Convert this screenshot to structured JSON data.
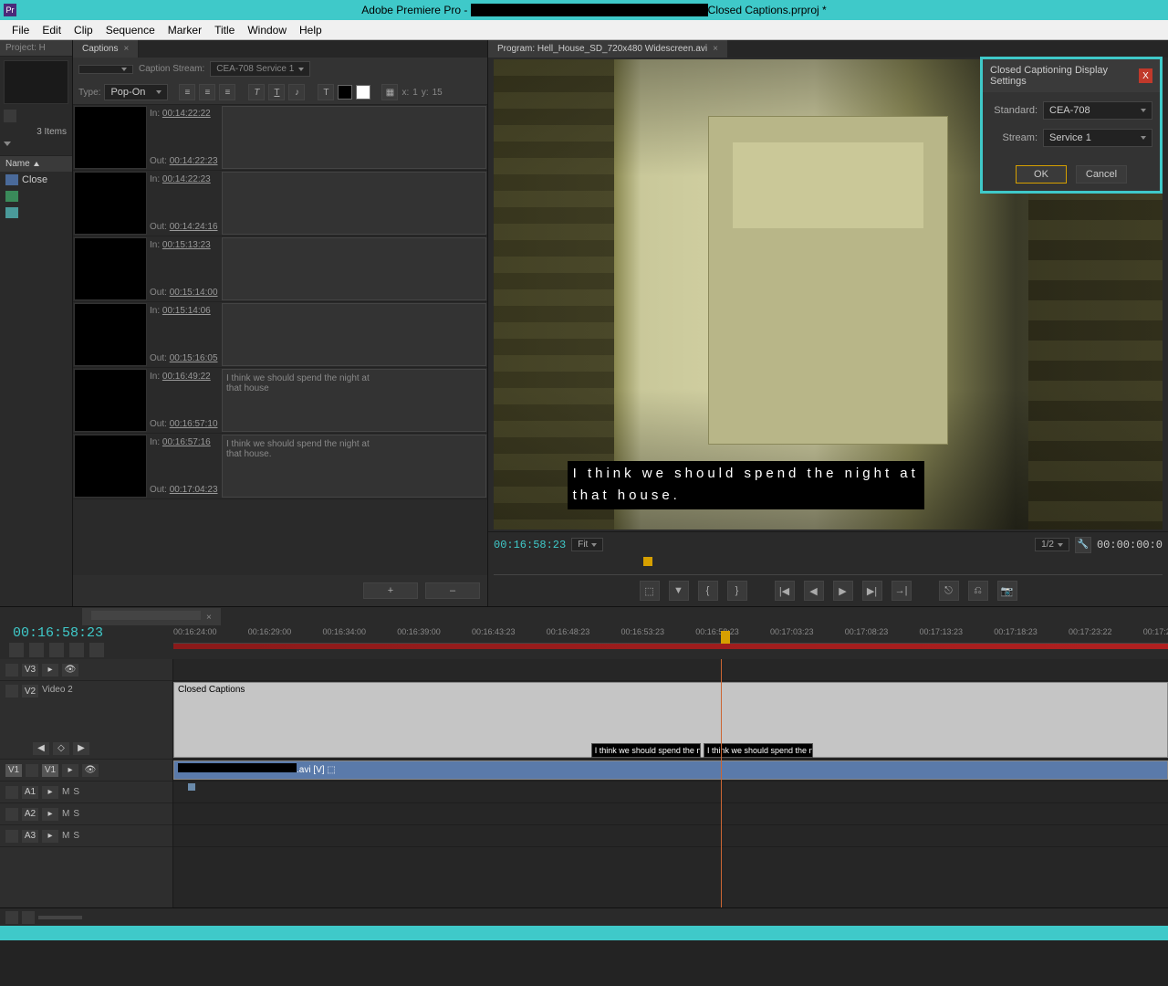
{
  "titlebar": {
    "app": "Adobe Premiere Pro - ",
    "file": "Closed Captions.prproj *"
  },
  "menu": [
    "File",
    "Edit",
    "Clip",
    "Sequence",
    "Marker",
    "Title",
    "Window",
    "Help"
  ],
  "project": {
    "tab": "Project: H",
    "items_count": "3 Items",
    "name_hdr": "Name",
    "items": [
      {
        "label": "Close"
      },
      {
        "label": ""
      },
      {
        "label": ""
      }
    ]
  },
  "captions": {
    "tab": "Captions",
    "stream_label": "Caption Stream:",
    "stream_value": "CEA-708 Service 1",
    "type_label": "Type:",
    "type_value": "Pop-On",
    "xy": {
      "x_label": "x:",
      "x_val": "1",
      "y_label": "y:",
      "y_val": "15"
    },
    "rows": [
      {
        "in": "00:14:22:22",
        "out": "00:14:22:23",
        "text": ""
      },
      {
        "in": "00:14:22:23",
        "out": "00:14:24:16",
        "text": ""
      },
      {
        "in": "00:15:13:23",
        "out": "00:15:14:00",
        "text": ""
      },
      {
        "in": "00:15:14:06",
        "out": "00:15:16:05",
        "text": ""
      },
      {
        "in": "00:16:49:22",
        "out": "00:16:57:10",
        "text": "I think we should spend the night at\nthat house"
      },
      {
        "in": "00:16:57:16",
        "out": "00:17:04:23",
        "text": "I think we should spend the night at\nthat house."
      }
    ],
    "in_lbl": "In:",
    "out_lbl": "Out:",
    "add": "+",
    "del": "–"
  },
  "program": {
    "tab": "Program: Hell_House_SD_720x480 Widescreen.avi",
    "cc_line1": "I think we should spend the night at",
    "cc_line2": "that house.",
    "timecode": "00:16:58:23",
    "fit": "Fit",
    "half": "1/2",
    "duration": "00:00:00:0"
  },
  "dialog": {
    "title": "Closed Captioning Display Settings",
    "standard_label": "Standard:",
    "standard_value": "CEA-708",
    "stream_label": "Stream:",
    "stream_value": "Service 1",
    "ok": "OK",
    "cancel": "Cancel"
  },
  "timeline": {
    "tab": "",
    "timecode": "00:16:58:23",
    "ticks": [
      "00:16:24:00",
      "00:16:29:00",
      "00:16:34:00",
      "00:16:39:00",
      "00:16:43:23",
      "00:16:48:23",
      "00:16:53:23",
      "00:16:58:23",
      "00:17:03:23",
      "00:17:08:23",
      "00:17:13:23",
      "00:17:18:23",
      "00:17:23:22",
      "00:17:2"
    ],
    "tracks": {
      "v3": "V3",
      "v2": "V2",
      "v2_name": "Video 2",
      "v1": "V1",
      "a1": "A1",
      "a2": "A2",
      "a3": "A3"
    },
    "cc_clip": "Closed Captions",
    "cc_block1": "I think we should spend the n",
    "cc_block2": "I think we should spend the n",
    "v1_clip": ".avi [V]"
  }
}
